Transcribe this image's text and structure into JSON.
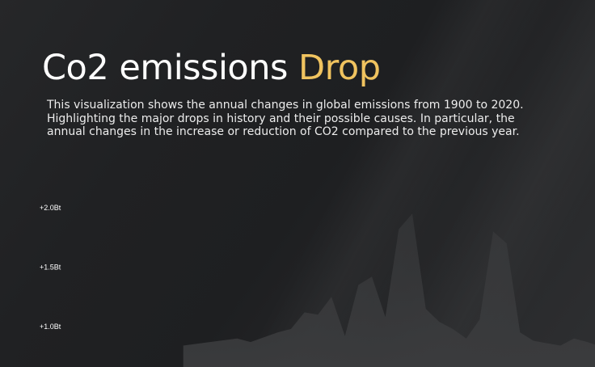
{
  "header": {
    "title_main": "Co2 emissions ",
    "title_accent": "Drop",
    "description": "This visualization shows the annual changes in global emissions from 1900 to 2020. Highlighting the major drops in history and their possible causes. In particular, the annual changes in the increase or reduction of CO2 compared to the previous year."
  },
  "colors": {
    "accent": "#f0c35f",
    "text": "#ffffff",
    "background": "#1e1f21",
    "area_fill": "#3b3c3e"
  },
  "chart_data": {
    "type": "area",
    "title": "",
    "xlabel": "",
    "ylabel": "",
    "x_range": [
      1900,
      2020
    ],
    "y_ticks": [
      {
        "value": 2.0,
        "label": "+2.0Bt"
      },
      {
        "value": 1.5,
        "label": "+1.5Bt"
      },
      {
        "value": 1.0,
        "label": "+1.0Bt"
      }
    ],
    "ylim": [
      0.75,
      2.2
    ],
    "grid": false,
    "series": [
      {
        "x": [
          1988,
          1992,
          1993,
          1995,
          1996,
          1997,
          1998,
          1999,
          2000,
          2001,
          2002,
          2003,
          2004,
          2005,
          2006,
          2007,
          2008,
          2009,
          2010,
          2011,
          2012,
          2013,
          2014,
          2015,
          2016,
          2017,
          2018,
          2019,
          2020
        ],
        "y": [
          0.84,
          0.9,
          0.87,
          0.95,
          0.98,
          1.12,
          1.1,
          1.25,
          0.92,
          1.35,
          1.42,
          1.08,
          1.82,
          1.95,
          1.15,
          1.04,
          0.98,
          0.9,
          1.06,
          1.8,
          1.7,
          0.95,
          0.88,
          0.86,
          0.84,
          0.9,
          0.87,
          0.83,
          0.8
        ]
      }
    ]
  }
}
